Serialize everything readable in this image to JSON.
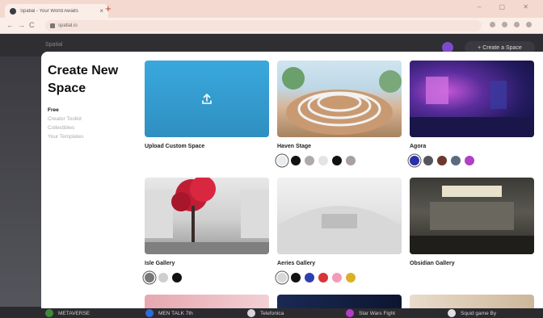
{
  "browser": {
    "tab_title": "Spatial - Your World Awaits",
    "tab_close": "×",
    "new_tab": "+",
    "window_controls": "–  ▢  ✕",
    "url": "spatial.io",
    "nav_back": "←",
    "nav_forward": "→",
    "nav_reload": "C"
  },
  "app": {
    "logo": "Spatial",
    "create_button": "+ Create a Space"
  },
  "modal": {
    "title": "Create New Space",
    "nav": [
      {
        "label": "Free",
        "active": true
      },
      {
        "label": "Creator Toolkit",
        "active": false
      },
      {
        "label": "Collectibles",
        "active": false
      },
      {
        "label": "Your Templates",
        "active": false
      }
    ],
    "upload": {
      "label": "Upload Custom Space",
      "icon": "upload-icon"
    },
    "spaces": [
      {
        "label": "Haven Stage",
        "swatches": [
          "#e9ecef",
          "#111111",
          "#b0a9a9",
          "#e4e4e4",
          "#111111",
          "#a9a0a0"
        ],
        "selected": 0
      },
      {
        "label": "Agora",
        "swatches": [
          "#2b2fa8",
          "#55555c",
          "#6b3a2a",
          "#5a6a80",
          "#b13fc7"
        ],
        "selected": 0
      },
      {
        "label": "Isle Gallery",
        "swatches": [
          "#777777",
          "#cfcfcf",
          "#111111"
        ],
        "selected": 0
      },
      {
        "label": "Aeries Gallery",
        "swatches": [
          "#d8d8d8",
          "#111111",
          "#2c3fb0",
          "#d8343a",
          "#f39bb8",
          "#d9b02a"
        ],
        "selected": 0
      },
      {
        "label": "Obsidian Gallery",
        "swatches": [],
        "selected": -1
      }
    ]
  },
  "background_spaces": [
    {
      "label": "METAVERSE",
      "color": "#3f8a3a"
    },
    {
      "label": "MEN TALK 7th",
      "color": "#2f6bd6"
    },
    {
      "label": "Telefonica",
      "color": "#d8d8d8"
    },
    {
      "label": "Star Wars Fight",
      "color": "#b43ac9"
    },
    {
      "label": "Squid game By",
      "color": "#e0e0e0"
    }
  ]
}
